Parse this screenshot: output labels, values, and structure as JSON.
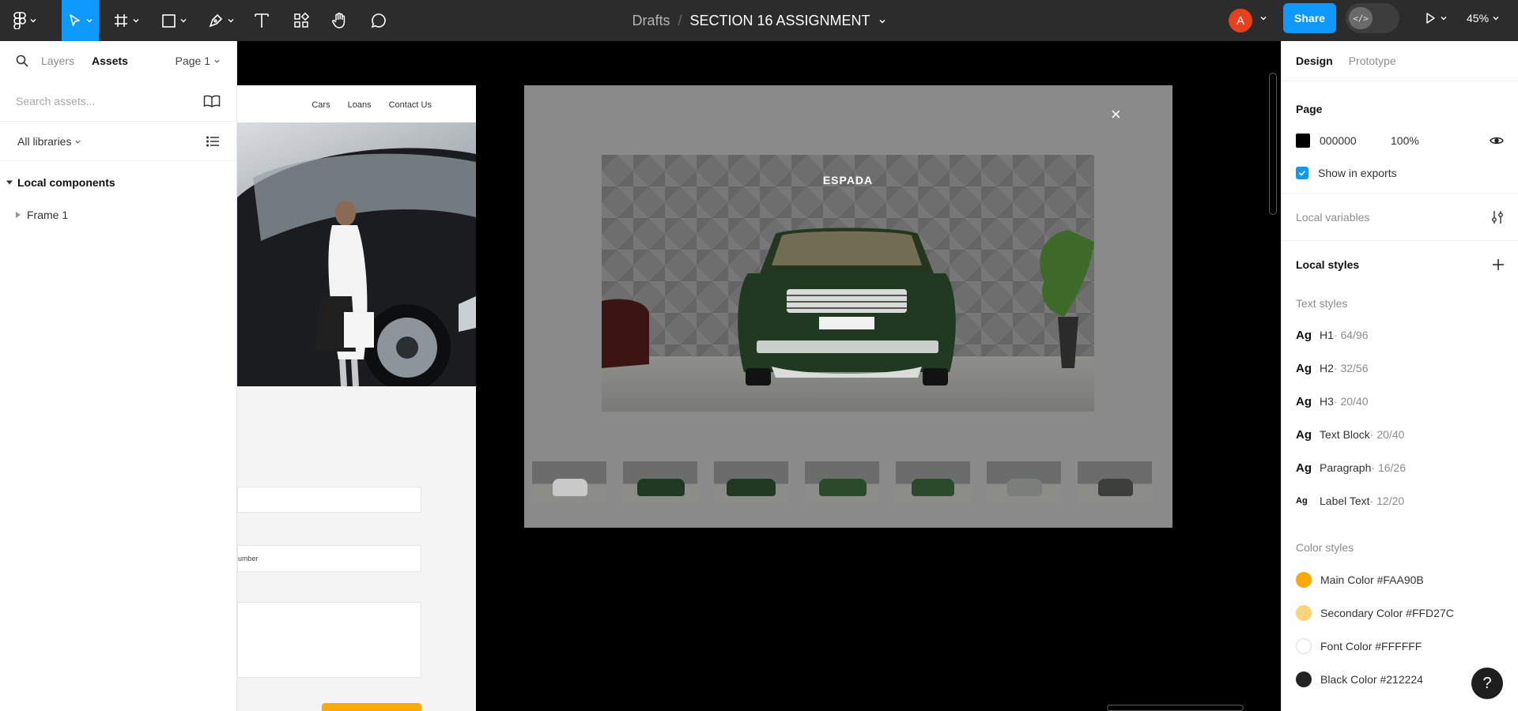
{
  "toolbar": {
    "breadcrumb_parent": "Drafts",
    "breadcrumb_sep": "/",
    "file_name": "SECTION 16 ASSIGNMENT",
    "avatar_initial": "A",
    "share_label": "Share",
    "devmode_glyph": "</>",
    "zoom": "45%",
    "accent_color": "#0d99ff"
  },
  "left_panel": {
    "tab_layers": "Layers",
    "tab_assets": "Assets",
    "page_selector": "Page 1",
    "search_placeholder": "Search assets...",
    "libraries": "All libraries",
    "section_title": "Local components",
    "items": [
      {
        "label": "Frame 1"
      }
    ]
  },
  "canvas": {
    "nav_links": [
      "Cars",
      "Loans",
      "Contact Us"
    ],
    "form_hint": "umber",
    "gallery_brand": "ESPADA",
    "close_glyph": "×",
    "thumbnail_count": 7
  },
  "right_panel": {
    "tab_design": "Design",
    "tab_prototype": "Prototype",
    "page_heading": "Page",
    "page_color_hex": "000000",
    "page_opacity": "100%",
    "show_in_exports": "Show in exports",
    "local_variables": "Local variables",
    "local_styles": "Local styles",
    "text_styles_heading": "Text styles",
    "text_styles": [
      {
        "glyph": "Ag",
        "name": "H1",
        "meta": " · 64/96"
      },
      {
        "glyph": "Ag",
        "name": "H2",
        "meta": " · 32/56"
      },
      {
        "glyph": "Ag",
        "name": "H3",
        "meta": " · 20/40"
      },
      {
        "glyph": "Ag",
        "name": "Text Block",
        "meta": " · 20/40"
      },
      {
        "glyph": "Ag",
        "name": "Paragraph",
        "meta": " · 16/26"
      },
      {
        "glyph": "Ag",
        "name": "Label Text",
        "meta": " · 12/20"
      }
    ],
    "color_styles_heading": "Color styles",
    "color_styles": [
      {
        "label": "Main Color #FAA90B",
        "color": "#FAA90B"
      },
      {
        "label": "Secondary Color #FFD27C",
        "color": "#FFD27C"
      },
      {
        "label": "Font Color #FFFFFF",
        "color": "#FFFFFF"
      },
      {
        "label": "Black Color #212224",
        "color": "#212224"
      }
    ],
    "help_glyph": "?"
  }
}
